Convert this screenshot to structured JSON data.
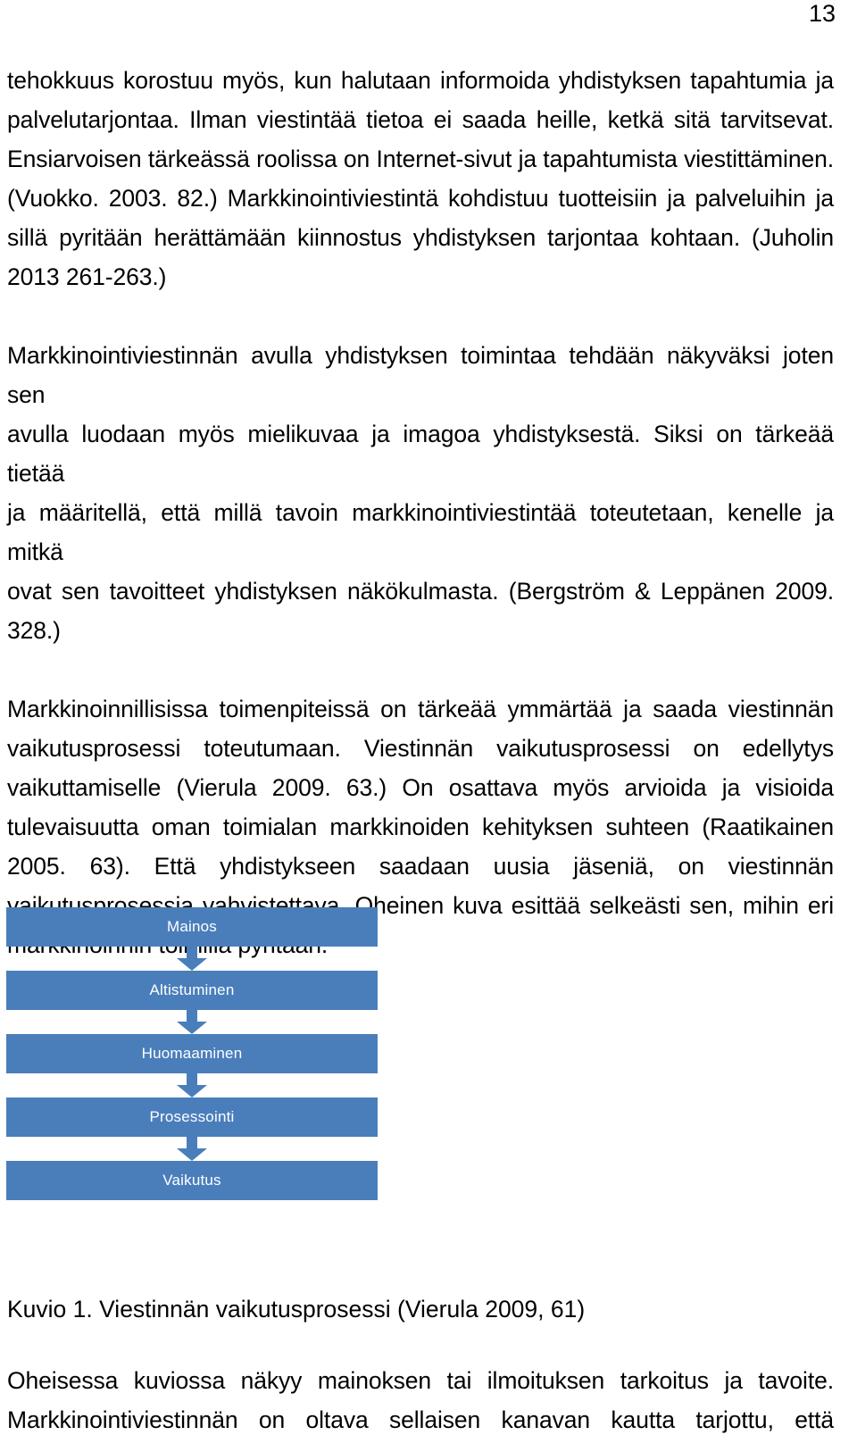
{
  "page": {
    "number": "13"
  },
  "paragraphs": [
    {
      "id": "par1",
      "lines": [
        "tehokkuus korostuu myös, kun halutaan informoida yhdistyksen tapahtumia ja",
        "palvelutarjontaa. Ilman viestintää tietoa ei saada heille, ketkä sitä tarvitsevat.",
        "Ensiarvoisen tärkeässä roolissa on Internet-sivut ja tapahtumista viestittäminen.",
        "(Vuokko. 2003. 82.) Markkinointiviestintä kohdistuu tuotteisiin ja palveluihin ja",
        "sillä pyritään herättämään kiinnostus yhdistyksen tarjontaa kohtaan. (Juholin",
        "2013 261-263.)"
      ]
    },
    {
      "id": "par2",
      "lines": [
        "Markkinointiviestinnän avulla yhdistyksen toimintaa tehdään näkyväksi joten sen",
        "avulla luodaan myös mielikuvaa ja imagoa yhdistyksestä. Siksi on tärkeää tietää",
        "ja määritellä, että millä tavoin markkinointiviestintää toteutetaan, kenelle ja mitkä",
        "ovat sen tavoitteet yhdistyksen näkökulmasta. (Bergström & Leppänen 2009.",
        "328.)"
      ]
    },
    {
      "id": "par3",
      "lines": [
        "Markkinoinnillisissa toimenpiteissä on tärkeää ymmärtää ja saada viestinnän",
        "vaikutusprosessi toteutumaan. Viestinnän vaikutusprosessi on edellytys",
        "vaikuttamiselle (Vierula 2009. 63.) On osattava myös arvioida ja visioida",
        "tulevaisuutta oman toimialan markkinoiden kehityksen suhteen (Raatikainen",
        "2005. 63). Että yhdistykseen saadaan uusia jäseniä, on viestinnän",
        "vaikutusprosessia vahvistettava. Oheinen kuva esittää selkeästi sen, mihin eri",
        "markkinoinnin toimilla pyritään."
      ]
    }
  ],
  "figure": {
    "accent_color": "#4a7ebb",
    "label_color": "#ffffff",
    "steps": [
      {
        "label": "Mainos"
      },
      {
        "label": "Altistuminen"
      },
      {
        "label": "Huomaaminen"
      },
      {
        "label": "Prosessointi"
      },
      {
        "label": "Vaikutus"
      }
    ],
    "caption": "Kuvio 1. Viestinnän vaikutusprosessi (Vierula 2009, 61)"
  },
  "trailing_paragraph": {
    "lines": [
      "Oheisessa kuviossa näkyy mainoksen tai ilmoituksen tarkoitus ja tavoite.",
      "Markkinointiviestinnän on oltava sellaisen kanavan kautta tarjottu, että"
    ]
  }
}
